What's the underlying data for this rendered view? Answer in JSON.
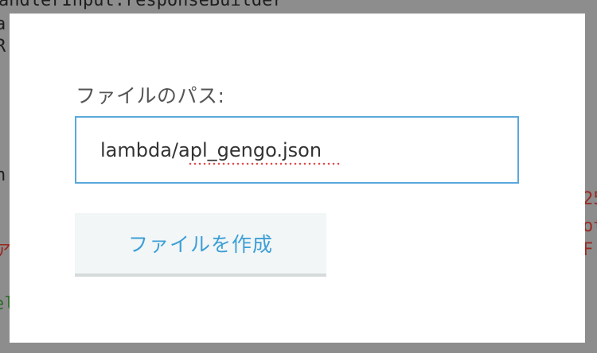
{
  "background": {
    "code_line_top": "andlerInput.responseBuilder",
    "code_line_a": "a",
    "code_line_r": "R",
    "code_line_n": "n",
    "code_right_1": "25",
    "code_right_2": "ot",
    "code_right_3": "F ]",
    "code_left_red": "ア",
    "code_left_green": "el"
  },
  "dialog": {
    "path_label": "ファイルのパス:",
    "path_value": "lambda/apl_gengo.json",
    "create_button_label": "ファイルを作成"
  },
  "colors": {
    "input_border": "#5aa8dc",
    "button_text": "#3d9fd6",
    "button_bg": "#f2f6f7"
  }
}
